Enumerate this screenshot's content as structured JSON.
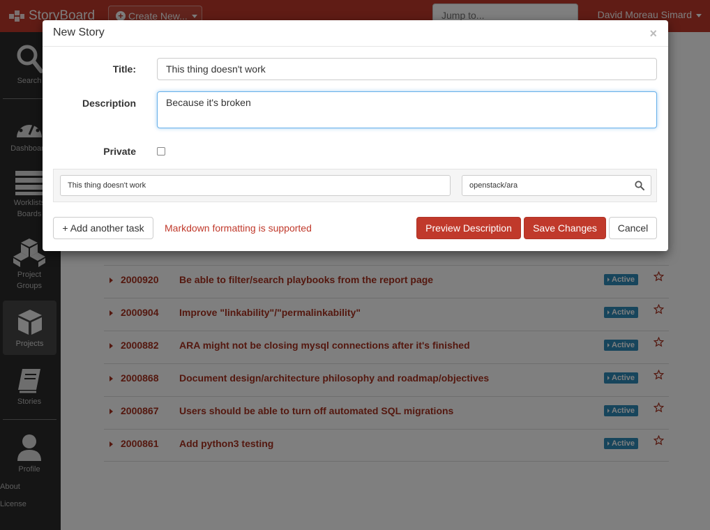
{
  "navbar": {
    "brand": "StoryBoard",
    "create_button": "Create New...",
    "jump_placeholder": "Jump to...",
    "user_name": "David Moreau Simard"
  },
  "sidebar": {
    "items": [
      {
        "label": "Search",
        "icon": "search-icon"
      },
      {
        "label": "Dashboard",
        "icon": "dashboard-icon"
      },
      {
        "label": "Worklists",
        "label2": "Boards",
        "icon": "worklists-icon"
      },
      {
        "label": "Project",
        "label2": "Groups",
        "icon": "project-groups-icon"
      },
      {
        "label": "Projects",
        "icon": "projects-icon",
        "active": true
      },
      {
        "label": "Stories",
        "icon": "stories-icon"
      },
      {
        "label": "Profile",
        "icon": "profile-icon"
      }
    ],
    "about": "About",
    "license": "License"
  },
  "stories": [
    {
      "id": "2000920",
      "title": "Be able to filter/search playbooks from the report page",
      "status": "Active"
    },
    {
      "id": "2000904",
      "title": "Improve \"linkability\"/\"permalinkability\"",
      "status": "Active"
    },
    {
      "id": "2000882",
      "title": "ARA might not be closing mysql connections after it's finished",
      "status": "Active"
    },
    {
      "id": "2000868",
      "title": "Document design/architecture philosophy and roadmap/objectives",
      "status": "Active"
    },
    {
      "id": "2000867",
      "title": "Users should be able to turn off automated SQL migrations",
      "status": "Active"
    },
    {
      "id": "2000861",
      "title": "Add python3 testing",
      "status": "Active"
    }
  ],
  "modal": {
    "title": "New Story",
    "close": "×",
    "title_label": "Title:",
    "title_value": "This thing doesn't work",
    "description_label": "Description",
    "description_value": "Because it's broken",
    "private_label": "Private",
    "private_checked": false,
    "task_value": "This thing doesn't work",
    "project_value": "openstack/ara",
    "add_task_button": "+ Add another task",
    "markdown_note": "Markdown formatting is supported",
    "preview_button": "Preview Description",
    "save_button": "Save Changes",
    "cancel_button": "Cancel"
  },
  "colors": {
    "brand_red": "#c0392b",
    "link_red": "#a8301f",
    "status_blue": "#2e8ab8",
    "sidebar_bg": "#2b2b2b"
  }
}
